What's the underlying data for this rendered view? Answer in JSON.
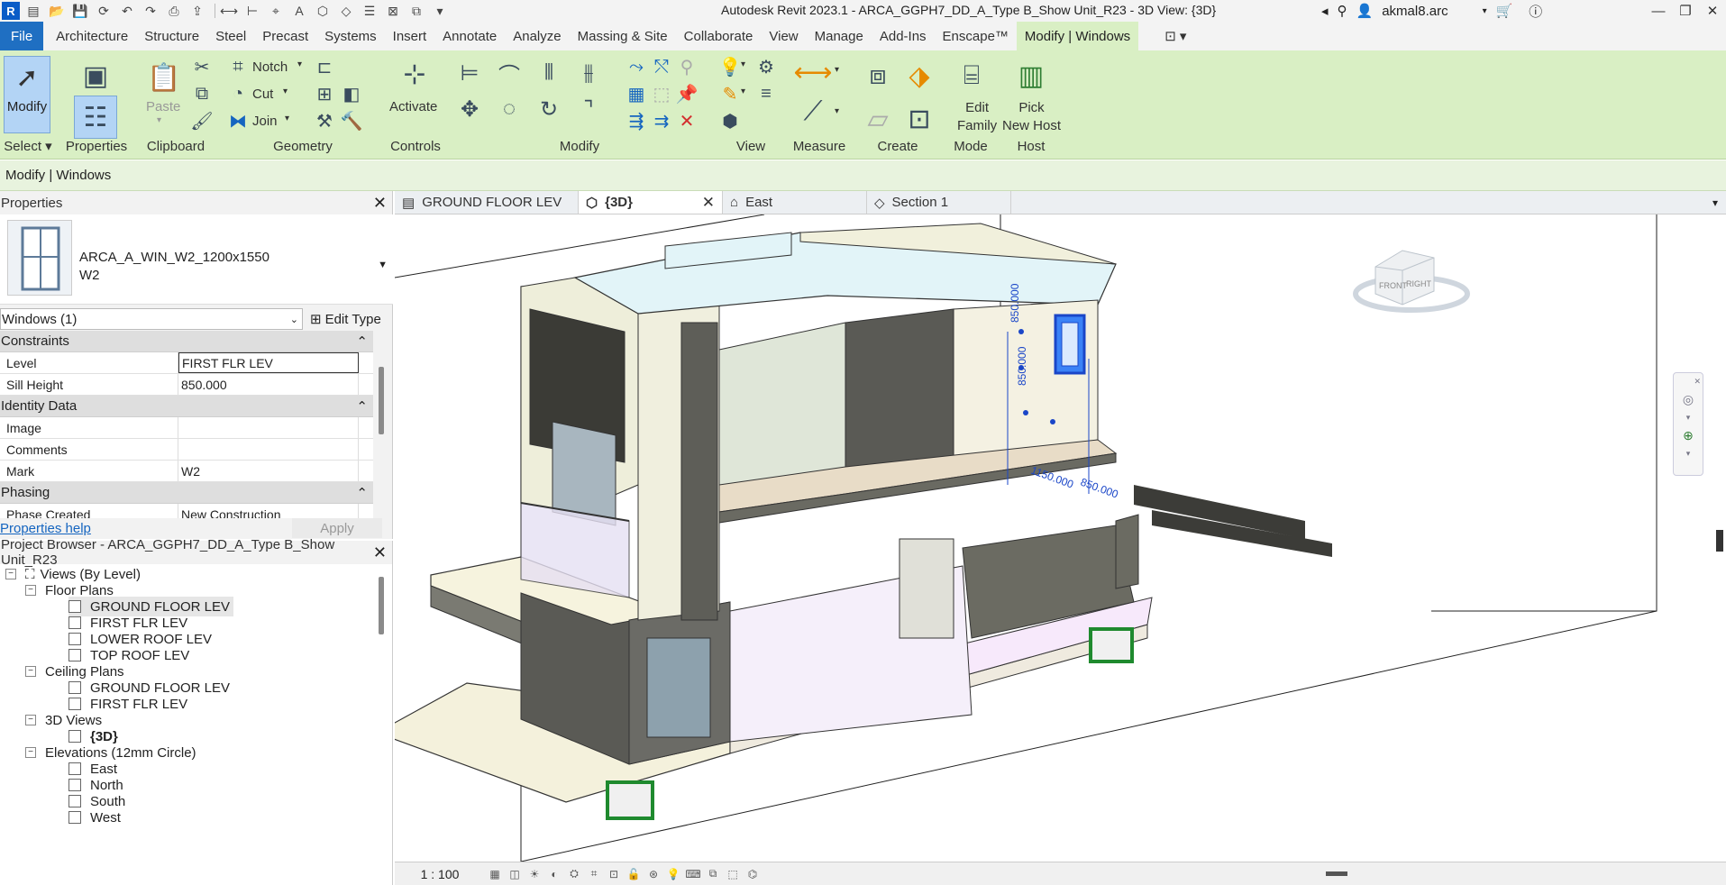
{
  "app": {
    "title": "Autodesk Revit 2023.1 - ARCA_GGPH7_DD_A_Type B_Show Unit_R23 - 3D View: {3D}",
    "logo": "R"
  },
  "user": {
    "name": "akmal8.arc"
  },
  "menu": {
    "file": "File",
    "tabs": [
      "Architecture",
      "Structure",
      "Steel",
      "Precast",
      "Systems",
      "Insert",
      "Annotate",
      "Analyze",
      "Massing & Site",
      "Collaborate",
      "View",
      "Manage",
      "Add-Ins",
      "Enscape™",
      "Modify | Windows"
    ],
    "active_tab": "Modify | Windows"
  },
  "ribbon": {
    "modify_label": "Modify",
    "paste_label": "Paste",
    "notch_label": "Notch",
    "cut_label": "Cut",
    "join_label": "Join",
    "activate_label": "Activate",
    "edit_family_label": "Edit Family",
    "edit_family_l1": "Edit",
    "edit_family_l2": "Family",
    "pick_host_l1": "Pick",
    "pick_host_l2": "New Host",
    "panels": {
      "select": "Select",
      "properties": "Properties",
      "clipboard": "Clipboard",
      "geometry": "Geometry",
      "controls": "Controls",
      "modify": "Modify",
      "view": "View",
      "measure": "Measure",
      "create": "Create",
      "mode": "Mode",
      "host": "Host"
    }
  },
  "options_bar": {
    "context": "Modify | Windows"
  },
  "properties": {
    "title": "Properties",
    "family": "ARCA_A_WIN_W2_1200x1550",
    "type": "W2",
    "instance_filter": "Windows (1)",
    "edit_type": "Edit Type",
    "groups": {
      "constraints": "Constraints",
      "identity": "Identity Data",
      "phasing": "Phasing"
    },
    "rows": {
      "level": {
        "key": "Level",
        "value": "FIRST FLR LEV"
      },
      "sill": {
        "key": "Sill Height",
        "value": "850.000"
      },
      "image": {
        "key": "Image",
        "value": ""
      },
      "comments": {
        "key": "Comments",
        "value": ""
      },
      "mark": {
        "key": "Mark",
        "value": "W2"
      },
      "phase_created": {
        "key": "Phase Created",
        "value": "New Construction"
      }
    },
    "help": "Properties help",
    "apply": "Apply"
  },
  "browser": {
    "title": "Project Browser - ARCA_GGPH7_DD_A_Type B_Show Unit_R23",
    "root": "Views (By Level)",
    "floor_plans": "Floor Plans",
    "fp_items": [
      "GROUND FLOOR LEV",
      "FIRST FLR LEV",
      "LOWER ROOF LEV",
      "TOP ROOF LEV"
    ],
    "ceiling_plans": "Ceiling Plans",
    "cp_items": [
      "GROUND FLOOR LEV",
      "FIRST FLR LEV"
    ],
    "views3d": "3D Views",
    "v3d_items": [
      "{3D}"
    ],
    "elevations": "Elevations (12mm Circle)",
    "elev_items": [
      "East",
      "North",
      "South",
      "West"
    ]
  },
  "view_tabs": [
    "GROUND FLOOR LEV",
    "{3D}",
    "East",
    "Section 1"
  ],
  "active_view_tab": "{3D}",
  "viewport": {
    "dim1": "850.000",
    "dim2": "850.000",
    "dim3": "1150.000",
    "dim4": "850.000",
    "viewcube_front": "FRONT",
    "viewcube_right": "RIGHT"
  },
  "view_control": {
    "scale": "1 : 100"
  },
  "colors": {
    "ribbon": "#d9efc4",
    "file_tab": "#1f6fc2",
    "selection": "#1a46c8"
  }
}
